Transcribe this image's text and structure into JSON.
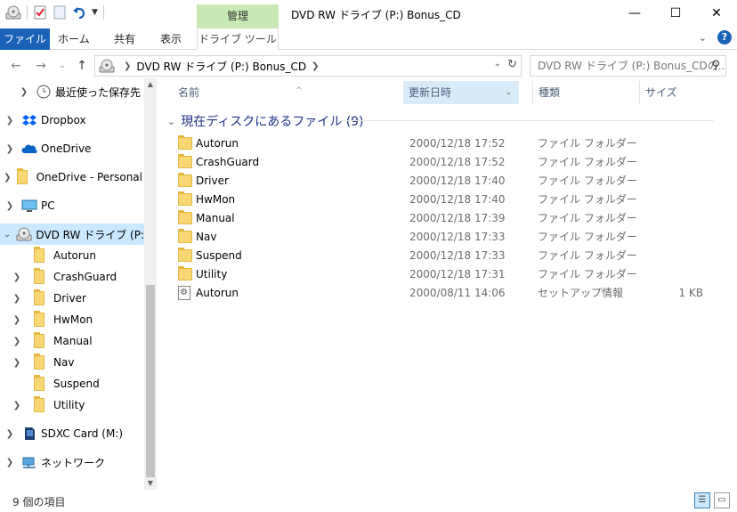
{
  "window": {
    "title": "DVD RW ドライブ (P:) Bonus_CD",
    "context_tab_header": "管理"
  },
  "ribbon": {
    "tabs": [
      "ファイル",
      "ホーム",
      "共有",
      "表示",
      "ドライブ ツール"
    ]
  },
  "address": {
    "path": "DVD RW ドライブ (P:) Bonus_CD",
    "search_placeholder": "DVD RW ドライブ (P:) Bonus_CDの..."
  },
  "nav": {
    "items": [
      {
        "label": "最近使った保存先",
        "icon": "clock-icon"
      },
      {
        "label": "Dropbox",
        "icon": "dropbox-icon"
      },
      {
        "label": "OneDrive",
        "icon": "onedrive-cloud-icon"
      },
      {
        "label": "OneDrive - Personal",
        "icon": "folder-icon"
      },
      {
        "label": "PC",
        "icon": "pc-icon"
      },
      {
        "label": "DVD RW ドライブ (P:) Bo",
        "icon": "dvd-drive-icon"
      },
      {
        "label": "Autorun",
        "icon": "folder-icon"
      },
      {
        "label": "CrashGuard",
        "icon": "folder-icon"
      },
      {
        "label": "Driver",
        "icon": "folder-icon"
      },
      {
        "label": "HwMon",
        "icon": "folder-icon"
      },
      {
        "label": "Manual",
        "icon": "folder-icon"
      },
      {
        "label": "Nav",
        "icon": "folder-icon"
      },
      {
        "label": "Suspend",
        "icon": "folder-icon"
      },
      {
        "label": "Utility",
        "icon": "folder-icon"
      },
      {
        "label": "SDXC Card (M:)",
        "icon": "sd-card-icon"
      },
      {
        "label": "ネットワーク",
        "icon": "network-icon"
      }
    ]
  },
  "columns": {
    "name": "名前",
    "date": "更新日時",
    "type": "種類",
    "size": "サイズ"
  },
  "group": {
    "title": "現在ディスクにあるファイル (9)"
  },
  "files": [
    {
      "name": "Autorun",
      "date": "2000/12/18 17:52",
      "type": "ファイル フォルダー",
      "size": ""
    },
    {
      "name": "CrashGuard",
      "date": "2000/12/18 17:52",
      "type": "ファイル フォルダー",
      "size": ""
    },
    {
      "name": "Driver",
      "date": "2000/12/18 17:40",
      "type": "ファイル フォルダー",
      "size": ""
    },
    {
      "name": "HwMon",
      "date": "2000/12/18 17:40",
      "type": "ファイル フォルダー",
      "size": ""
    },
    {
      "name": "Manual",
      "date": "2000/12/18 17:39",
      "type": "ファイル フォルダー",
      "size": ""
    },
    {
      "name": "Nav",
      "date": "2000/12/18 17:33",
      "type": "ファイル フォルダー",
      "size": ""
    },
    {
      "name": "Suspend",
      "date": "2000/12/18 17:33",
      "type": "ファイル フォルダー",
      "size": ""
    },
    {
      "name": "Utility",
      "date": "2000/12/18 17:31",
      "type": "ファイル フォルダー",
      "size": ""
    },
    {
      "name": "Autorun",
      "date": "2000/08/11 14:06",
      "type": "セットアップ情報",
      "size": "1 KB"
    }
  ],
  "status": {
    "item_count": "9 個の項目"
  },
  "colors": {
    "file_tab": "#1a62b8",
    "context_tab": "#c9e9b4",
    "selection": "#cce8ff",
    "group_title": "#1e3287"
  }
}
